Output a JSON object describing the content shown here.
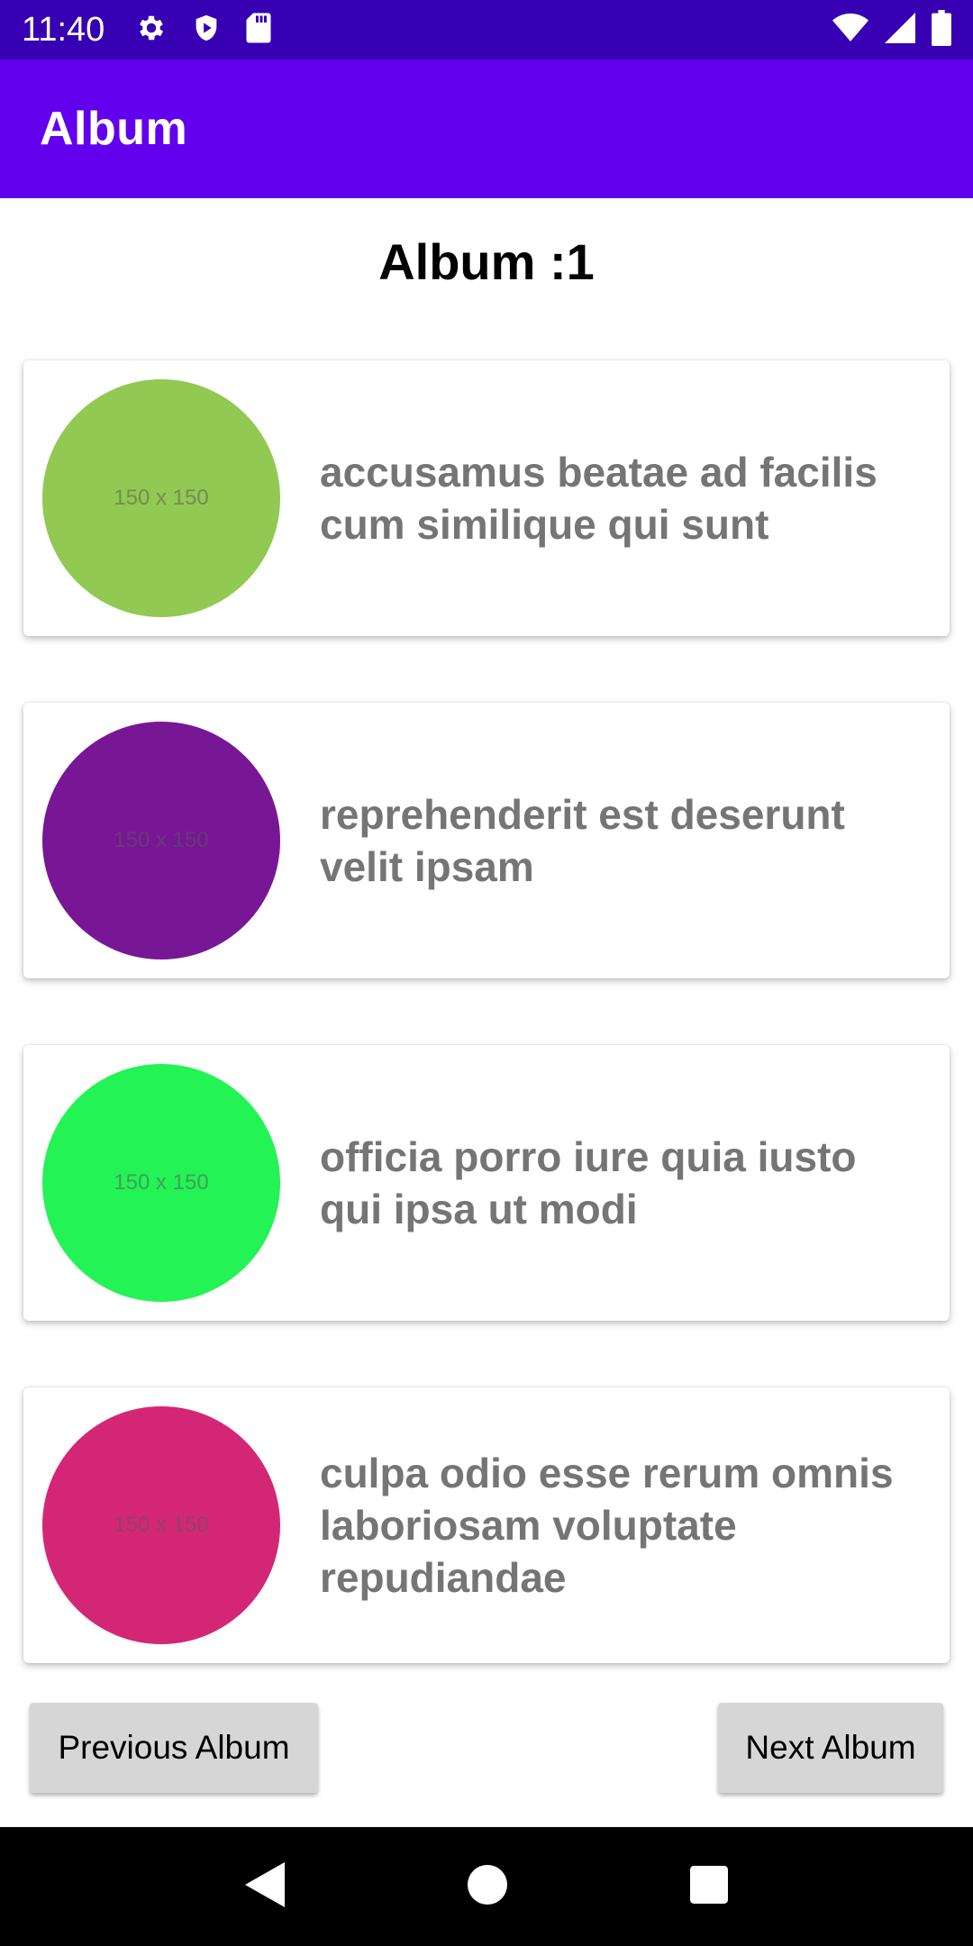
{
  "status_bar": {
    "time": "11:40",
    "left_icons": [
      "settings-icon",
      "shield-icon",
      "sd-card-icon"
    ],
    "right_icons": [
      "wifi-icon",
      "signal-icon",
      "battery-icon"
    ]
  },
  "app_bar": {
    "title": "Album"
  },
  "heading": "Album :1",
  "albums": [
    {
      "title": "accusamus beatae ad facilis cum similique qui sunt",
      "thumb_label": "150 x 150",
      "color": "#92c952"
    },
    {
      "title": "reprehenderit est deserunt velit ipsam",
      "thumb_label": "150 x 150",
      "color": "#771796"
    },
    {
      "title": "officia porro iure quia iusto qui ipsa ut modi",
      "thumb_label": "150 x 150",
      "color": "#24f355"
    },
    {
      "title": "culpa odio esse rerum omnis laboriosam voluptate repudiandae",
      "thumb_label": "150 x 150",
      "color": "#d32776"
    }
  ],
  "buttons": {
    "previous": "Previous Album",
    "next": "Next Album"
  },
  "nav_bar": {
    "icons": [
      "back-icon",
      "home-icon",
      "recents-icon"
    ]
  }
}
